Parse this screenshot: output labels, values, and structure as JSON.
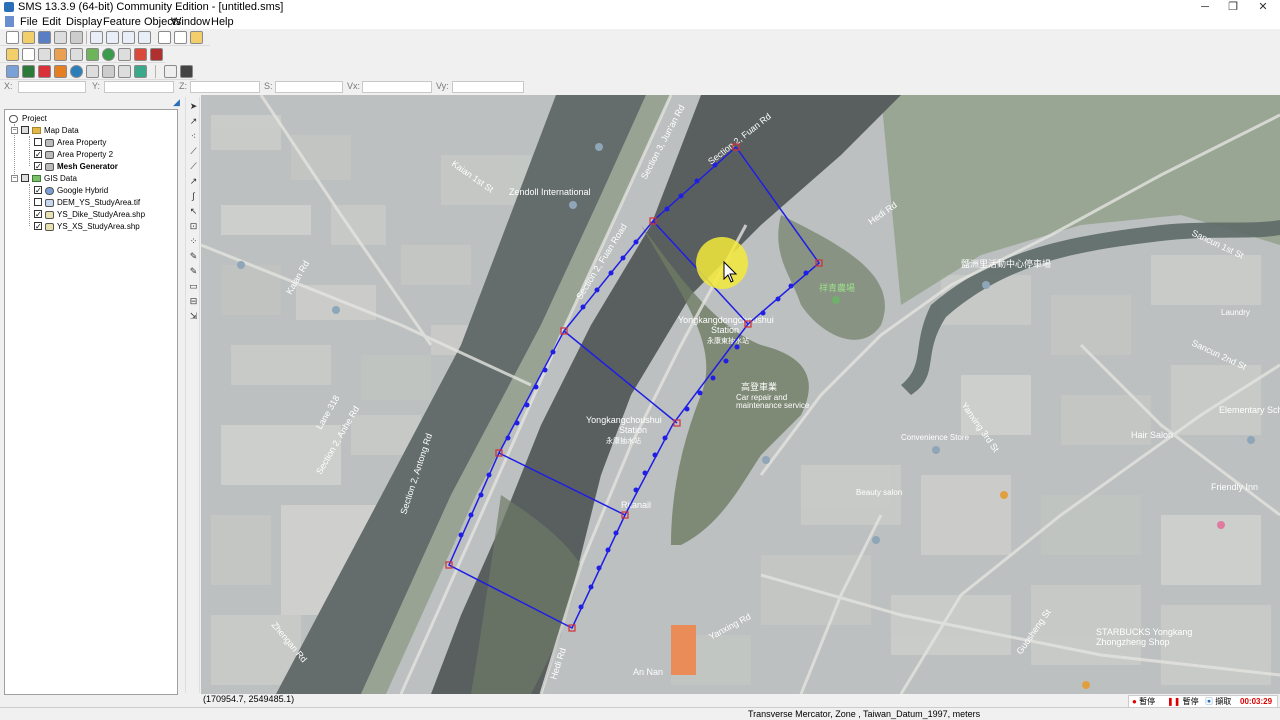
{
  "window": {
    "title": "SMS 13.3.9 (64-bit) Community Edition - [untitled.sms]",
    "minimize": "─",
    "maximize": "❐",
    "close": "✕"
  },
  "menu": [
    "File",
    "Edit",
    "Display",
    "Feature Objects",
    "Window",
    "Help"
  ],
  "coord_fields": {
    "labels": [
      "X:",
      "Y:",
      "Z:",
      "S:",
      "Vx:",
      "Vy:"
    ]
  },
  "tree": {
    "project": "Project",
    "map_data": "Map Data",
    "area_property": "Area Property",
    "area_property_2": "Area Property 2",
    "mesh_generator": "Mesh Generator",
    "gis_data": "GIS Data",
    "google_hybrid": "Google Hybrid",
    "dem": "DEM_YS_StudyArea.tif",
    "dike": "YS_Dike_StudyArea.shp",
    "xs": "YS_XS_StudyArea.shp",
    "expand_minus": "−",
    "check_mark": "✓"
  },
  "map_labels": {
    "road1": "Section 3, Jun'an Rd",
    "road2": "Section 2, Fuan Road",
    "road3": "Section 2, Fuan Rd",
    "road4": "Section 2, Anhe Rd",
    "road5": "Section 2, Antong Rd",
    "road6": "Lane 318",
    "road7": "Kaian 1st St",
    "road8": "Kaian Rd",
    "road9": "Hedi Rd",
    "road10": "Hedi Rd",
    "road11": "Zhengan Rd",
    "road12": "Yanxing Rd",
    "road13": "Sancun 1st St",
    "road14": "Sancun 2nd St",
    "road15": "Guosheng St",
    "road16": "Yanxing 3rd St",
    "station1": "Yongkangdongchoushui",
    "station1b": "Station",
    "station1c": "永康東抽水站",
    "station2": "Yongkangchoushui",
    "station2b": "Station",
    "station2c": "永康抽水站",
    "poi1": "Zendoll International",
    "poi2": "An Nan",
    "poi3": "Car repair and",
    "poi4": "maintenance service",
    "poi5": "高登車業",
    "poi6": "Beauty salon",
    "poi7": "Friendly Inn",
    "poi8": "Elementary Sch",
    "poi9": "STARBUCKS Yongkang",
    "poi10": "Zhongzheng Shop",
    "poi11": "Hair Salon",
    "poi12": "Laundry",
    "poi13": "Ritanail",
    "poi14": "祥青農場",
    "poi15": "鹽洲里活動中心停車場",
    "poi16": "Convenience Store"
  },
  "status": {
    "coords": "(170954.7, 2549485.1)",
    "projection": "Transverse Mercator, Zone , Taiwan_Datum_1997, meters"
  },
  "recorder": {
    "btn1": "暫停",
    "btn2": "暫停",
    "btn3": "擷取",
    "time": "00:03:29"
  }
}
